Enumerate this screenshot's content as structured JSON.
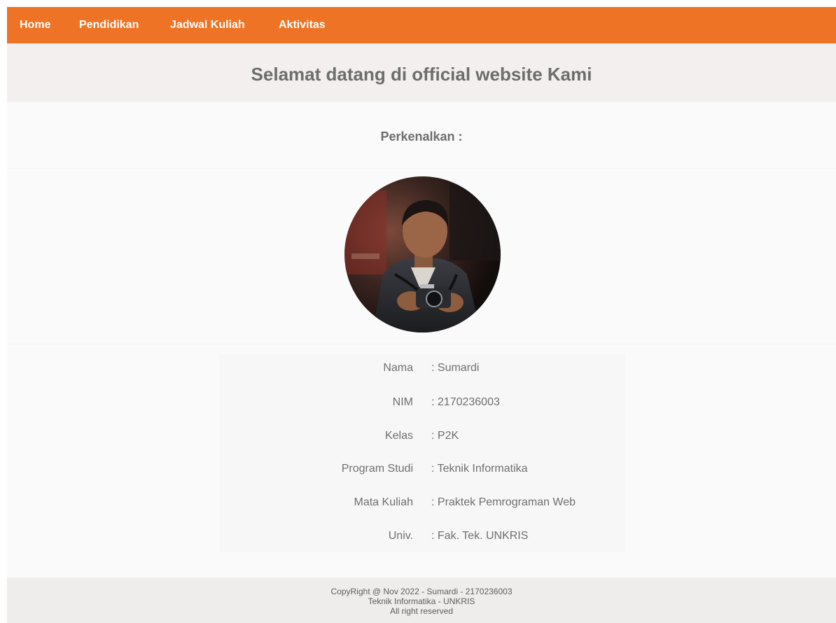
{
  "nav": {
    "items": [
      {
        "label": "Home"
      },
      {
        "label": "Pendidikan"
      },
      {
        "label": "Jadwal Kuliah"
      },
      {
        "label": "Aktivitas"
      }
    ]
  },
  "header": {
    "title": "Selamat datang di official website Kami"
  },
  "intro": {
    "subtitle": "Perkenalkan :"
  },
  "profile": {
    "photo_icon": "profile-photo",
    "rows": [
      {
        "label": "Nama",
        "value": ": Sumardi"
      },
      {
        "label": "NIM",
        "value": ": 2170236003"
      },
      {
        "label": "Kelas",
        "value": ": P2K"
      },
      {
        "label": "Program Studi",
        "value": ": Teknik Informatika"
      },
      {
        "label": "Mata Kuliah",
        "value": ": Praktek Pemrograman Web"
      },
      {
        "label": "Univ.",
        "value": ": Fak. Tek. UNKRIS"
      }
    ]
  },
  "footer": {
    "line1": "CopyRight @ Nov 2022 - Sumardi - 2170236003",
    "line2": "Teknik Informatika - UNKRIS",
    "line3": "All right reserved"
  },
  "colors": {
    "nav_bg": "#ee7324",
    "header_bg": "#f2efee",
    "text": "#6d6d6d"
  }
}
